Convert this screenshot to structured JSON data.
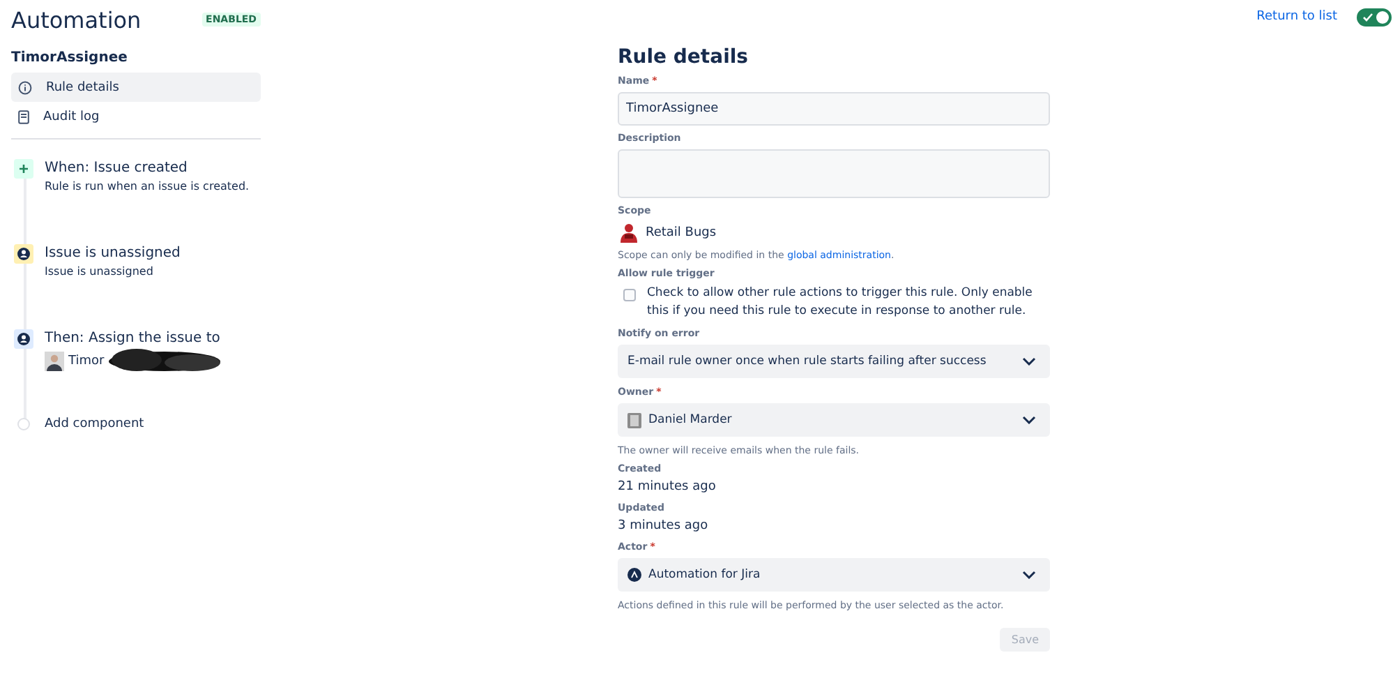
{
  "header": {
    "title": "Automation",
    "status_badge": "ENABLED",
    "return_link": "Return to list",
    "enabled_toggle": {
      "on": true
    }
  },
  "sidebar": {
    "rule_name": "TimorAssignee",
    "nav": [
      {
        "label": "Rule details",
        "selected": true
      },
      {
        "label": "Audit log",
        "selected": false
      }
    ]
  },
  "components": [
    {
      "kind": "trigger",
      "title": "When: Issue created",
      "detail": "Rule is run when an issue is created."
    },
    {
      "kind": "condition",
      "title": "Issue is unassigned",
      "detail": "Issue is unassigned"
    },
    {
      "kind": "action",
      "title": "Then: Assign the issue to",
      "assignee": "Timor"
    },
    {
      "kind": "add",
      "title": "Add component"
    }
  ],
  "form": {
    "heading": "Rule details",
    "name": {
      "label": "Name",
      "required_mark": "*",
      "value": "TimorAssignee"
    },
    "description": {
      "label": "Description"
    },
    "scope": {
      "label": "Scope",
      "project": "Retail Bugs",
      "note": "Scope can only be modified in the",
      "note_link": "global administration",
      "note_end": "."
    },
    "allow_rule_trigger": {
      "label": "Allow rule trigger",
      "checkbox_text": "Check to allow other rule actions to trigger this rule. Only enable this if you need this rule to execute in response to another rule.",
      "checked": false
    },
    "notify_on_error": {
      "label": "Notify on error",
      "value": "E-mail rule owner once when rule starts failing after success"
    },
    "owner": {
      "label": "Owner",
      "required_mark": "*",
      "value": "Daniel Marder",
      "help": "The owner will receive emails when the rule fails."
    },
    "created": {
      "label": "Created",
      "value": "21 minutes ago"
    },
    "updated": {
      "label": "Updated",
      "value": "3 minutes ago"
    },
    "actor": {
      "label": "Actor",
      "required_mark": "*",
      "value": "Automation for Jira",
      "help": "Actions defined in this rule will be performed by the user selected as the actor."
    },
    "save_button": {
      "label": "Save",
      "disabled": true
    }
  }
}
